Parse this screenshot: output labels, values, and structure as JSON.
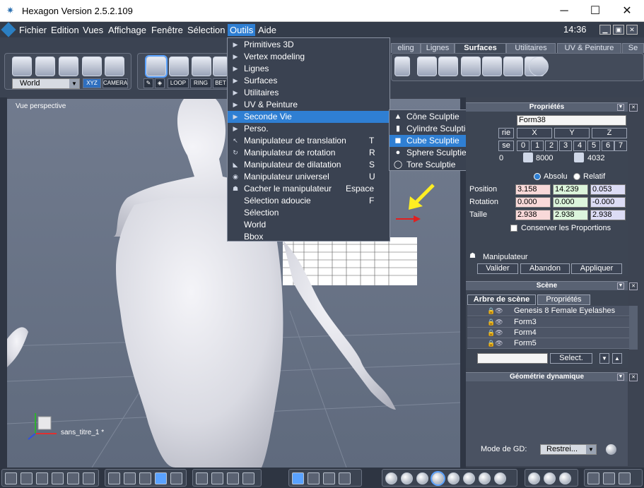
{
  "window": {
    "title": "Hexagon Version 2.5.2.109",
    "minimize": "─",
    "maximize": "☐",
    "close": "✕"
  },
  "menubar": {
    "items": [
      "Fichier",
      "Edition",
      "Vues",
      "Affichage",
      "Fenêtre",
      "Sélection",
      "Outils",
      "Aide"
    ],
    "active": "Outils",
    "clock": "14:36"
  },
  "toolbar": {
    "world_select": "World",
    "xyz_button": "XYZ",
    "camera_button": "CAMERA",
    "loop_button": "LOOP",
    "ring_button": "RING",
    "bet_button": "BET",
    "tabs": [
      "eling",
      "Lignes",
      "Surfaces",
      "Utilitaires",
      "UV & Peinture",
      "Se"
    ],
    "active_tab": "Surfaces"
  },
  "outils_menu": {
    "items": [
      {
        "label": "Primitives 3D",
        "icon": "▶",
        "key": ""
      },
      {
        "label": "Vertex modeling",
        "icon": "▶",
        "key": ""
      },
      {
        "label": "Lignes",
        "icon": "▶",
        "key": ""
      },
      {
        "label": "Surfaces",
        "icon": "▶",
        "key": ""
      },
      {
        "label": "Utilitaires",
        "icon": "▶",
        "key": ""
      },
      {
        "label": "UV & Peinture",
        "icon": "▶",
        "key": ""
      },
      {
        "label": "Seconde Vie",
        "icon": "▶",
        "key": ""
      },
      {
        "label": "Perso.",
        "icon": "▶",
        "key": ""
      },
      {
        "label": "Manipulateur de translation",
        "icon": "↖",
        "key": "T"
      },
      {
        "label": "Manipulateur de rotation",
        "icon": "↻",
        "key": "R"
      },
      {
        "label": "Manipulateur de dilatation",
        "icon": "◣",
        "key": "S"
      },
      {
        "label": "Manipulateur universel",
        "icon": "◉",
        "key": "U"
      },
      {
        "label": "Cacher le manipulateur",
        "icon": "☗",
        "key": "Espace"
      },
      {
        "label": "Sélection adoucie",
        "icon": "",
        "key": "F"
      },
      {
        "label": "Sélection",
        "icon": "",
        "key": ""
      },
      {
        "label": "World",
        "icon": "",
        "key": ""
      },
      {
        "label": "Bbox",
        "icon": "",
        "key": ""
      }
    ],
    "highlighted": "Seconde Vie"
  },
  "seconde_submenu": {
    "items": [
      {
        "label": "Cône Sculptie",
        "icon": "▲"
      },
      {
        "label": "Cylindre Sculptie",
        "icon": "▮"
      },
      {
        "label": "Cube Sculptie",
        "icon": "◼"
      },
      {
        "label": "Sphere Sculptie",
        "icon": "●"
      },
      {
        "label": "Tore Sculptie",
        "icon": "◯"
      }
    ],
    "highlighted": "Cube Sculptie"
  },
  "viewport": {
    "label": "Vue perspective",
    "document_name": "sans_titre_1 *"
  },
  "properties": {
    "title": "Propriétés",
    "name": "Form38",
    "tab_partial": "rie",
    "axes": [
      "X",
      "Y",
      "Z"
    ],
    "se_partial": "se",
    "levels": [
      "0",
      "1",
      "2",
      "3",
      "4",
      "5",
      "6",
      "7"
    ],
    "count_partial": "0",
    "count_a": "8000",
    "count_b": "4032",
    "absolu": "Absolu",
    "relatif": "Relatif",
    "position_label": "Position",
    "position": [
      "3.158",
      "14.239",
      "0.053"
    ],
    "rotation_label": "Rotation",
    "rotation": [
      "0.000",
      "0.000",
      "-0.000"
    ],
    "taille_label": "Taille",
    "taille": [
      "2.938",
      "2.938",
      "2.938"
    ],
    "conserver": "Conserver les Proportions",
    "manipulateur": "Manipulateur",
    "valider": "Valider",
    "abandon": "Abandon",
    "appliquer": "Appliquer"
  },
  "scene": {
    "title": "Scène",
    "tab_tree": "Arbre de scène",
    "tab_props": "Propriétés",
    "rows": [
      "Genesis 8 Female Eyelashes",
      "Form3",
      "Form4",
      "Form5"
    ],
    "select_button": "Select."
  },
  "dyn_geometry": {
    "title": "Géométrie dynamique",
    "mode_label": "Mode de GD:",
    "mode_value": "Restrei..."
  }
}
